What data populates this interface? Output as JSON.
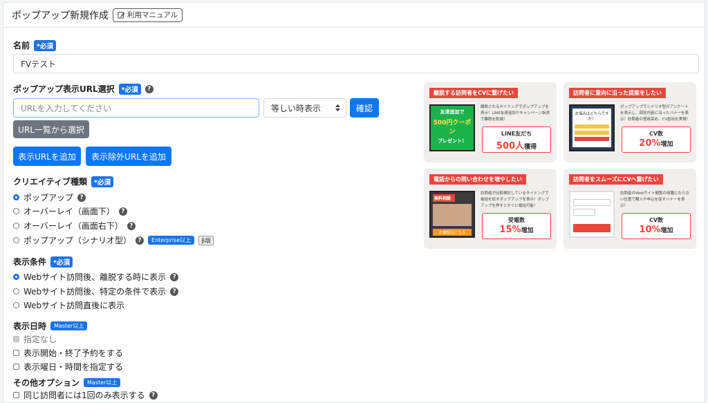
{
  "header": {
    "title": "ポップアップ新規作成",
    "manual_label": "利用マニュアル"
  },
  "name_section": {
    "label": "名前",
    "required": "*必須",
    "value": "FVテスト"
  },
  "url_section": {
    "label": "ポップアップ表示URL選択",
    "required": "*必須",
    "placeholder": "URLを入力してください",
    "match_select": "等しい時表示",
    "confirm_label": "確認",
    "list_select_label": "URL一覧から選択",
    "add_url_label": "表示URLを追加",
    "add_exclude_label": "表示除外URLを追加"
  },
  "creative_section": {
    "label": "クリエイティブ種類",
    "required": "*必須",
    "options": [
      {
        "label": "ポップアップ",
        "selected": true
      },
      {
        "label": "オーバーレイ（画面下）",
        "selected": false
      },
      {
        "label": "オーバーレイ（画面右下）",
        "selected": false
      },
      {
        "label": "ポップアップ（シナリオ型）",
        "selected": false,
        "badge": "Enterprise以上",
        "beta": "β版"
      }
    ]
  },
  "condition_section": {
    "label": "表示条件",
    "required": "*必須",
    "options": [
      {
        "label": "Webサイト訪問後、離脱する時に表示",
        "selected": true
      },
      {
        "label": "Webサイト訪問後、特定の条件で表示",
        "selected": false
      },
      {
        "label": "Webサイト訪問直後に表示",
        "selected": false
      }
    ]
  },
  "datetime_section": {
    "label": "表示日時",
    "badge": "Master以上",
    "options": [
      {
        "label": "指定なし",
        "checked": true,
        "disabled": true
      },
      {
        "label": "表示開始・終了予約をする",
        "checked": false
      },
      {
        "label": "表示曜日・時間を指定する",
        "checked": false
      }
    ]
  },
  "other_section": {
    "label": "その他オプション",
    "badge": "Master以上",
    "options": [
      {
        "label": "同じ訪問者には1回のみ表示する",
        "checked": false
      }
    ]
  },
  "cards": [
    {
      "headline": "離脱する訪問者をCVに繋げたい",
      "desc": "離脱されるタイミングでポップアップを表示！LINE友達追加やキャンペーン訴求で離脱を削減！",
      "metric": "LINE友だち",
      "big": "500人",
      "suffix": "獲得",
      "thumb_texts": [
        "友達追加で",
        "500円クーポン",
        "プレゼント！"
      ],
      "thumb_color": "#1bb24b"
    },
    {
      "headline": "訪問者に意向に沿った提案をしたい",
      "desc": "ポップアップでシナリオ型のアンケートを表示し、回答内容に沿ったバナーを表示！訪問者の意欲高め、CV創出を実現！",
      "metric": "CV数",
      "big": "20%",
      "suffix": "増加",
      "thumb_texts": [
        "お悩みはどちらですか？"
      ],
      "thumb_color": "#2a3a55"
    },
    {
      "headline": "電話からの問い合わせを増やしたい",
      "desc": "訪問者が比較検討しているタイミングで電話を促すポップアップを表示！ポップアップを押すとすぐに電話可能！",
      "metric": "受電数",
      "big": "15%",
      "suffix": "増加",
      "thumb_texts": [
        "無料相談",
        "お電話はこちら"
      ],
      "thumb_color": "#3a3a3a"
    },
    {
      "headline": "訪問者をスムーズにCVへ繋げたい",
      "desc": "訪問者のWebサイト閲覧の邪魔にならない位置で購入や申込を促すバナーを表示！",
      "metric": "CV数",
      "big": "10%",
      "suffix": "増加",
      "thumb_texts": [],
      "thumb_color": "#ffffff"
    }
  ],
  "colors": {
    "primary": "#0d77f2",
    "secondary": "#6c757d",
    "accent": "#e8473c"
  },
  "icons": {
    "manual": "edit-icon",
    "help": "question-circle-icon",
    "select": "sort-caret-icon"
  }
}
